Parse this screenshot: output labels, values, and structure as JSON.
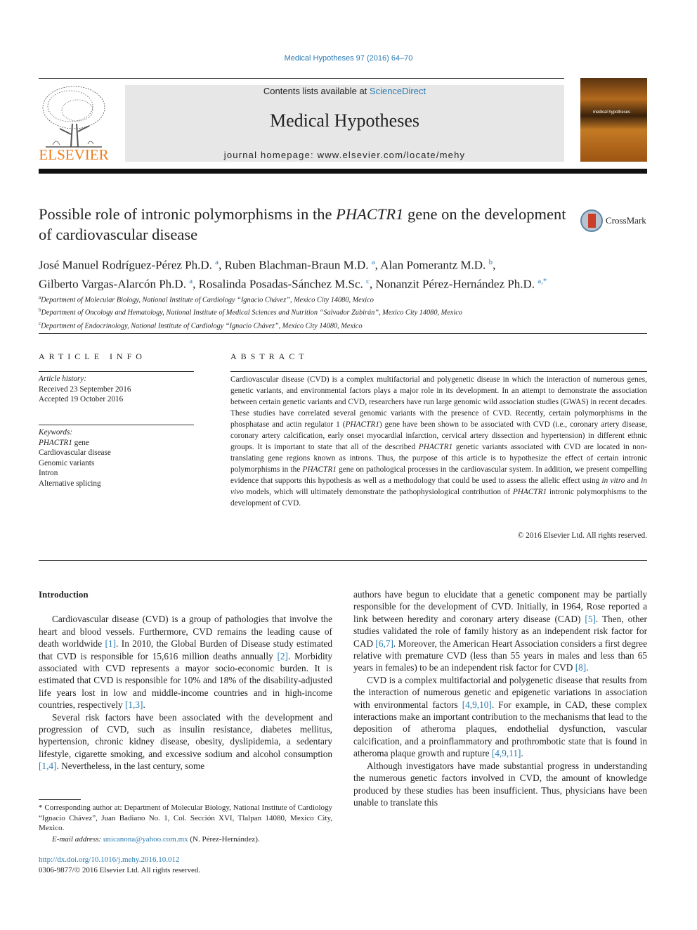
{
  "header": {
    "journal_ref": "Medical Hypotheses 97 (2016) 64–70",
    "contents_prefix": "Contents lists available at ",
    "contents_link": "ScienceDirect",
    "journal_title": "Medical Hypotheses",
    "homepage": "journal homepage: www.elsevier.com/locate/mehy",
    "publisher_logo": "ELSEVIER",
    "cover_title": "medical hypotheses",
    "crossmark": "CrossMark"
  },
  "article": {
    "title_part1": "Possible role of intronic polymorphisms in the ",
    "title_gene": "PHACTR1",
    "title_part2": " gene on the development of cardiovascular disease",
    "authors": [
      {
        "name": "José Manuel Rodríguez-Pérez Ph.D.",
        "aff": "a",
        "sep": ", "
      },
      {
        "name": "Ruben Blachman-Braun M.D.",
        "aff": "a",
        "sep": ", "
      },
      {
        "name": "Alan Pomerantz M.D.",
        "aff": "b",
        "sep": ","
      },
      {
        "name": "Gilberto Vargas-Alarcón Ph.D.",
        "aff": "a",
        "sep": ", "
      },
      {
        "name": "Rosalinda Posadas-Sánchez M.Sc.",
        "aff": "c",
        "sep": ", "
      },
      {
        "name": "Nonanzit Pérez-Hernández Ph.D.",
        "aff": "a,*",
        "sep": ""
      }
    ],
    "affiliations": [
      {
        "key": "a",
        "text": "Department of Molecular Biology, National Institute of Cardiology “Ignacio Chávez”, Mexico City 14080, Mexico"
      },
      {
        "key": "b",
        "text": "Department of Oncology and Hematology, National Institute of Medical Sciences and Nutrition “Salvador Zubirán”, Mexico City 14080, Mexico"
      },
      {
        "key": "c",
        "text": "Department of Endocrinology, National Institute of Cardiology “Ignacio Chávez”, Mexico City 14080, Mexico"
      }
    ]
  },
  "article_info": {
    "heading": "ARTICLE INFO",
    "history_label": "Article history:",
    "received": "Received 23 September 2016",
    "accepted": "Accepted 19 October 2016",
    "keywords_label": "Keywords:",
    "keywords": [
      "PHACTR1 gene",
      "Cardiovascular disease",
      "Genomic variants",
      "Intron",
      "Alternative splicing"
    ]
  },
  "abstract": {
    "heading": "ABSTRACT",
    "text": "Cardiovascular disease (CVD) is a complex multifactorial and polygenetic disease in which the interaction of numerous genes, genetic variants, and environmental factors plays a major role in its development. In an attempt to demonstrate the association between certain genetic variants and CVD, researchers have run large genomic wild association studies (GWAS) in recent decades. These studies have correlated several genomic variants with the presence of CVD. Recently, certain polymorphisms in the phosphatase and actin regulator 1 (PHACTR1) gene have been shown to be associated with CVD (i.e., coronary artery disease, coronary artery calcification, early onset myocardial infarction, cervical artery dissection and hypertension) in different ethnic groups. It is important to state that all of the described PHACTR1 genetic variants associated with CVD are located in non-translating gene regions known as introns. Thus, the purpose of this article is to hypothesize the effect of certain intronic polymorphisms in the PHACTR1 gene on pathological processes in the cardiovascular system. In addition, we present compelling evidence that supports this hypothesis as well as a methodology that could be used to assess the allelic effect using in vitro and in vivo models, which will ultimately demonstrate the pathophysiological contribution of PHACTR1 intronic polymorphisms to the development of CVD.",
    "copyright": "© 2016 Elsevier Ltd. All rights reserved."
  },
  "body": {
    "intro_heading": "Introduction",
    "left_paragraphs": [
      "Cardiovascular disease (CVD) is a group of pathologies that involve the heart and blood vessels. Furthermore, CVD remains the leading cause of death worldwide [1]. In 2010, the Global Burden of Disease study estimated that CVD is responsible for 15,616 million deaths annually [2]. Morbidity associated with CVD represents a mayor socio-economic burden. It is estimated that CVD is responsible for 10% and 18% of the disability-adjusted life years lost in low and middle-income countries and in high-income countries, respectively [1,3].",
      "Several risk factors have been associated with the development and progression of CVD, such as insulin resistance, diabetes mellitus, hypertension, chronic kidney disease, obesity, dyslipidemia, a sedentary lifestyle, cigarette smoking, and excessive sodium and alcohol consumption [1,4]. Nevertheless, in the last century, some"
    ],
    "right_paragraphs": [
      "authors have begun to elucidate that a genetic component may be partially responsible for the development of CVD. Initially, in 1964, Rose reported a link between heredity and coronary artery disease (CAD) [5]. Then, other studies validated the role of family history as an independent risk factor for CAD [6,7]. Moreover, the American Heart Association considers a first degree relative with premature CVD (less than 55 years in males and less than 65 years in females) to be an independent risk factor for CVD [8].",
      "CVD is a complex multifactorial and polygenetic disease that results from the interaction of numerous genetic and epigenetic variations in association with environmental factors [4,9,10]. For example, in CAD, these complex interactions make an important contribution to the mechanisms that lead to the deposition of atheroma plaques, endothelial dysfunction, vascular calcification, and a proinflammatory and prothrombotic state that is found in atheroma plaque growth and rupture [4,9,11].",
      "Although investigators have made substantial progress in understanding the numerous genetic factors involved in CVD, the amount of knowledge produced by these studies has been insufficient. Thus, physicians have been unable to translate this"
    ]
  },
  "footnote": {
    "corresponding": "* Corresponding author at: Department of Molecular Biology, National Institute of Cardiology “Ignacio Chávez”, Juan Badiano No. 1, Col. Sección XVI, Tlalpan 14080, Mexico City, Mexico.",
    "email_label": "E-mail address: ",
    "email": "unicanona@yahoo.com.mx",
    "email_owner": " (N. Pérez-Hernández).",
    "doi": "http://dx.doi.org/10.1016/j.mehy.2016.10.012",
    "issn": "0306-9877/© 2016 Elsevier Ltd. All rights reserved."
  },
  "colors": {
    "link": "#2a7ab0",
    "elsevier_orange": "#f07c1a",
    "banner_bg": "#e7e7e7"
  }
}
